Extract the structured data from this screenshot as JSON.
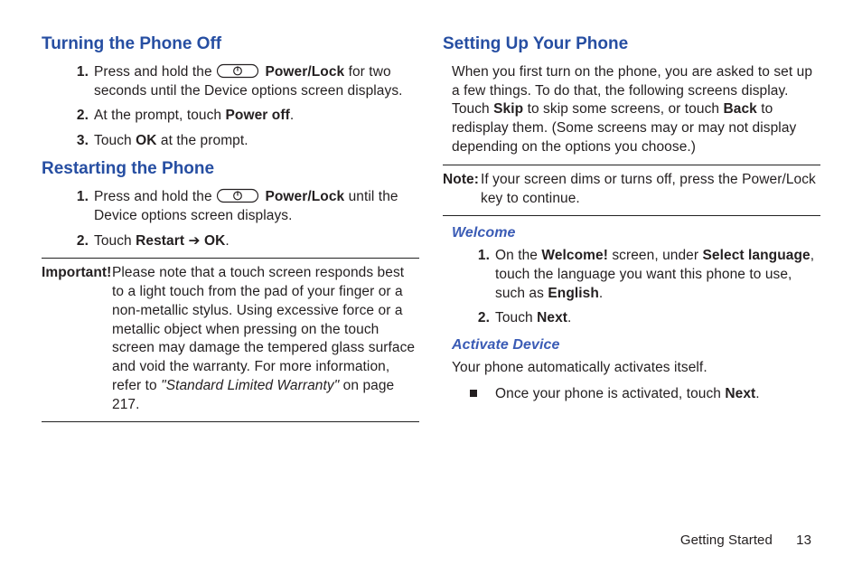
{
  "left": {
    "heading1": "Turning the Phone Off",
    "steps1": {
      "s1a": "Press and hold the ",
      "s1b": "Power/Lock",
      "s1c": " for two seconds until the Device options screen displays.",
      "s2a": "At the prompt, touch ",
      "s2b": "Power off",
      "s2c": ".",
      "s3a": "Touch ",
      "s3b": "OK",
      "s3c": " at the prompt."
    },
    "heading2": "Restarting the Phone",
    "steps2": {
      "s1a": "Press and hold the ",
      "s1b": "Power/Lock",
      "s1c": " until the Device options screen displays.",
      "s2a": "Touch ",
      "s2b": "Restart",
      "s2arrow": " ➔ ",
      "s2c": "OK",
      "s2d": "."
    },
    "important_label": "Important! ",
    "important_body_a": "Please note that a touch screen responds best to a light touch from the pad of your finger or a non-metallic stylus. Using excessive force or a metallic object when pressing on the touch screen may damage the tempered glass surface and void the warranty. For more information, refer to ",
    "important_body_b": "\"Standard Limited Warranty\"",
    "important_body_c": " on page 217."
  },
  "right": {
    "heading1": "Setting Up Your Phone",
    "intro_a": "When you first turn on the phone, you are asked to set up a few things. To do that, the following screens display. Touch ",
    "intro_skip": "Skip",
    "intro_b": " to skip some screens, or touch ",
    "intro_back": "Back",
    "intro_c": " to redisplay them. (Some screens may or may not display depending on the options you choose.)",
    "note_label": "Note: ",
    "note_body": "If your screen dims or turns off, press the Power/Lock key to continue.",
    "welcome_heading": "Welcome",
    "welcome_steps": {
      "s1a": "On the ",
      "s1b": "Welcome!",
      "s1c": " screen, under ",
      "s1d": "Select language",
      "s1e": ", touch the language you want this phone to use, such as ",
      "s1f": "English",
      "s1g": ".",
      "s2a": "Touch ",
      "s2b": "Next",
      "s2c": "."
    },
    "activate_heading": "Activate Device",
    "activate_intro": "Your phone automatically activates itself.",
    "activate_bullet_a": "Once your phone is activated, touch ",
    "activate_bullet_b": "Next",
    "activate_bullet_c": "."
  },
  "footer": {
    "section": "Getting Started",
    "page": "13"
  },
  "nums": {
    "n1": "1.",
    "n2": "2.",
    "n3": "3."
  }
}
